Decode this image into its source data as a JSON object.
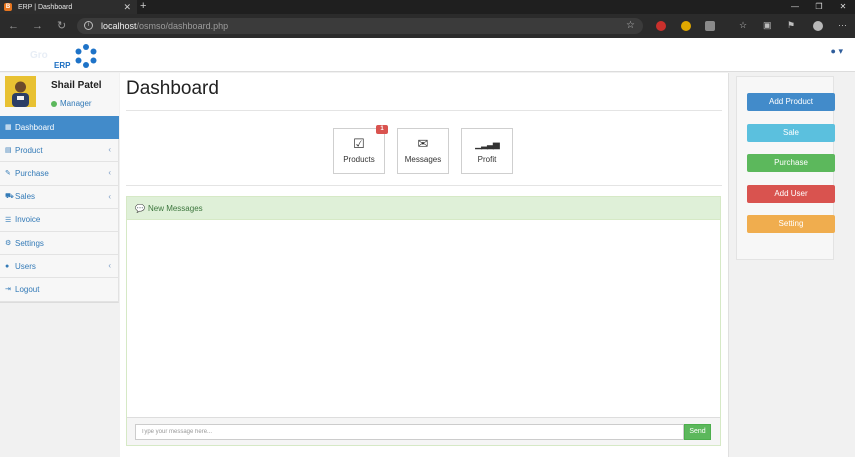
{
  "browser": {
    "tab_title": "ERP | Dashboard",
    "tab_favicon_letter": "B",
    "new_tab": "+",
    "url_host": "localhost",
    "url_path": "/osmso/dashboard.php"
  },
  "brand": {
    "logo_line1": "Gro",
    "logo_line2": "ERP"
  },
  "user_menu": "▾",
  "profile": {
    "name": "Shail Patel",
    "role": "Manager"
  },
  "sidebar": {
    "items": [
      {
        "label": "Dashboard",
        "icon": "table-icon",
        "glyph": "▦",
        "active": true
      },
      {
        "label": "Product",
        "icon": "list-icon",
        "glyph": "▤",
        "caret": "‹"
      },
      {
        "label": "Purchase",
        "icon": "pencil-icon",
        "glyph": "✎",
        "caret": "‹"
      },
      {
        "label": "Sales",
        "icon": "cart-icon",
        "glyph": "⛟",
        "caret": "‹"
      },
      {
        "label": "Invoice",
        "icon": "list-icon",
        "glyph": "☰"
      },
      {
        "label": "Settings",
        "icon": "gears-icon",
        "glyph": "⚙"
      },
      {
        "label": "Users",
        "icon": "user-icon",
        "glyph": "●",
        "caret": "‹"
      },
      {
        "label": "Logout",
        "icon": "sign-out-icon",
        "glyph": "⇥"
      }
    ]
  },
  "main": {
    "title": "Dashboard",
    "tiles": [
      {
        "label": "Products",
        "icon": "check-square-icon",
        "glyph": "☑",
        "badge": "1"
      },
      {
        "label": "Messages",
        "icon": "envelope-icon",
        "glyph": "✉"
      },
      {
        "label": "Profit",
        "icon": "signal-icon",
        "glyph": "▁▂▃▅"
      }
    ],
    "messages_panel": {
      "title": "New Messages",
      "input_placeholder": "Type your message here...",
      "send_label": "Send"
    }
  },
  "quick_actions": [
    {
      "label": "Add Product",
      "color": "#428bca"
    },
    {
      "label": "Sale",
      "color": "#5bc0de"
    },
    {
      "label": "Purchase",
      "color": "#5cb85c"
    },
    {
      "label": "Add User",
      "color": "#d9534f"
    },
    {
      "label": "Setting",
      "color": "#f0ad4e"
    }
  ]
}
